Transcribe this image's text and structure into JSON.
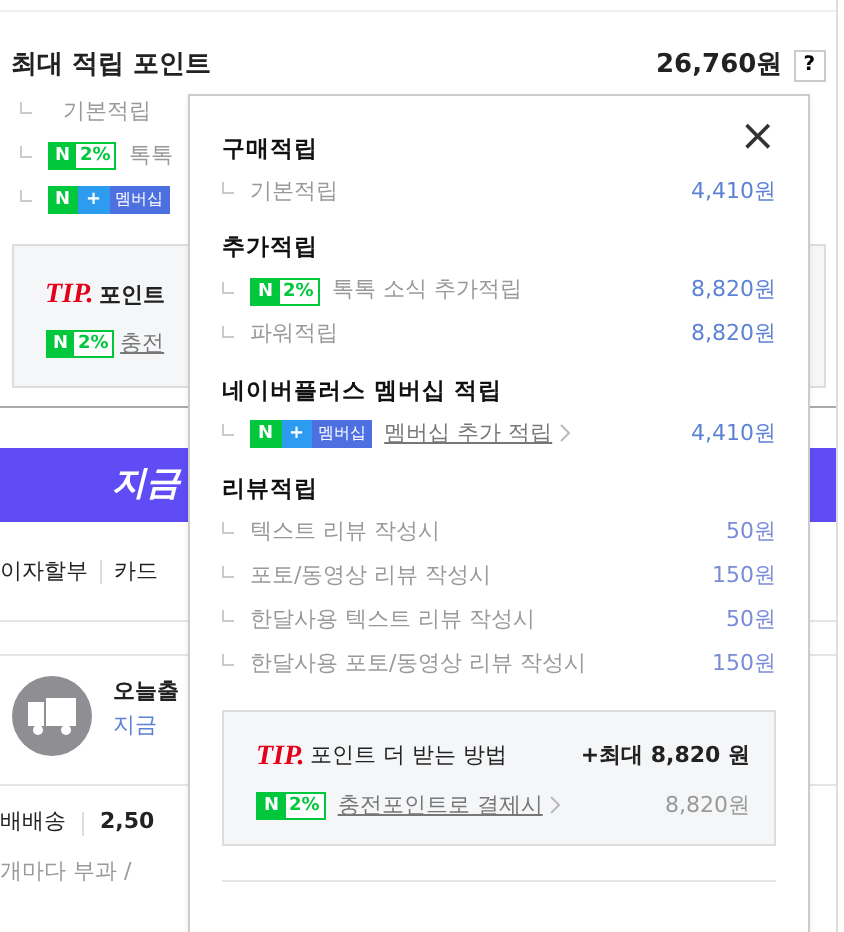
{
  "background": {
    "title": "최대 적립 포인트",
    "total": "26,760원",
    "help_button": "?",
    "items": [
      {
        "kind": "text",
        "label": "기본적립"
      },
      {
        "kind": "npay",
        "badge": [
          "N",
          "2%"
        ],
        "label": "톡톡"
      },
      {
        "kind": "membership",
        "badge": [
          "N",
          "+",
          "멤버십"
        ]
      }
    ],
    "tip": {
      "mark": "TIP.",
      "text": "포인트",
      "badge": [
        "N",
        "2%"
      ],
      "link": "충전"
    },
    "banner": "지금",
    "payment": [
      "이자할부",
      "카드"
    ],
    "delivery": {
      "title": "오늘출",
      "link": "지금"
    },
    "shipping": {
      "method": "배배송",
      "fee": "2,50"
    },
    "note": "개마다 부과 /"
  },
  "popup": {
    "close": "×",
    "sections": [
      {
        "title": "구매적립",
        "rows": [
          {
            "kind": "text",
            "label": "기본적립",
            "amount": "4,410원"
          }
        ]
      },
      {
        "title": "추가적립",
        "rows": [
          {
            "kind": "npay",
            "badge": [
              "N",
              "2%"
            ],
            "label": "톡톡 소식 추가적립",
            "amount": "8,820원"
          },
          {
            "kind": "text",
            "label": "파워적립",
            "amount": "8,820원"
          }
        ]
      },
      {
        "title": "네이버플러스 멤버십 적립",
        "rows": [
          {
            "kind": "membership",
            "badge": [
              "N",
              "+",
              "멤버십"
            ],
            "label": "멤버십 추가 적립",
            "amount": "4,410원"
          }
        ]
      },
      {
        "title": "리뷰적립",
        "rows": [
          {
            "kind": "review",
            "label": "텍스트 리뷰 작성시",
            "amount": "50원"
          },
          {
            "kind": "review",
            "label": "포토/동영상 리뷰 작성시",
            "amount": "150원"
          },
          {
            "kind": "review",
            "label": "한달사용 텍스트 리뷰 작성시",
            "amount": "50원"
          },
          {
            "kind": "review",
            "label": "한달사용 포토/동영상 리뷰 작성시",
            "amount": "150원"
          }
        ]
      }
    ],
    "tip": {
      "mark": "TIP.",
      "text": "포인트 더 받는 방법",
      "max": "+최대 8,820 원",
      "badge": [
        "N",
        "2%"
      ],
      "link": "충전포인트로 결제시",
      "amount": "8,820원"
    }
  }
}
